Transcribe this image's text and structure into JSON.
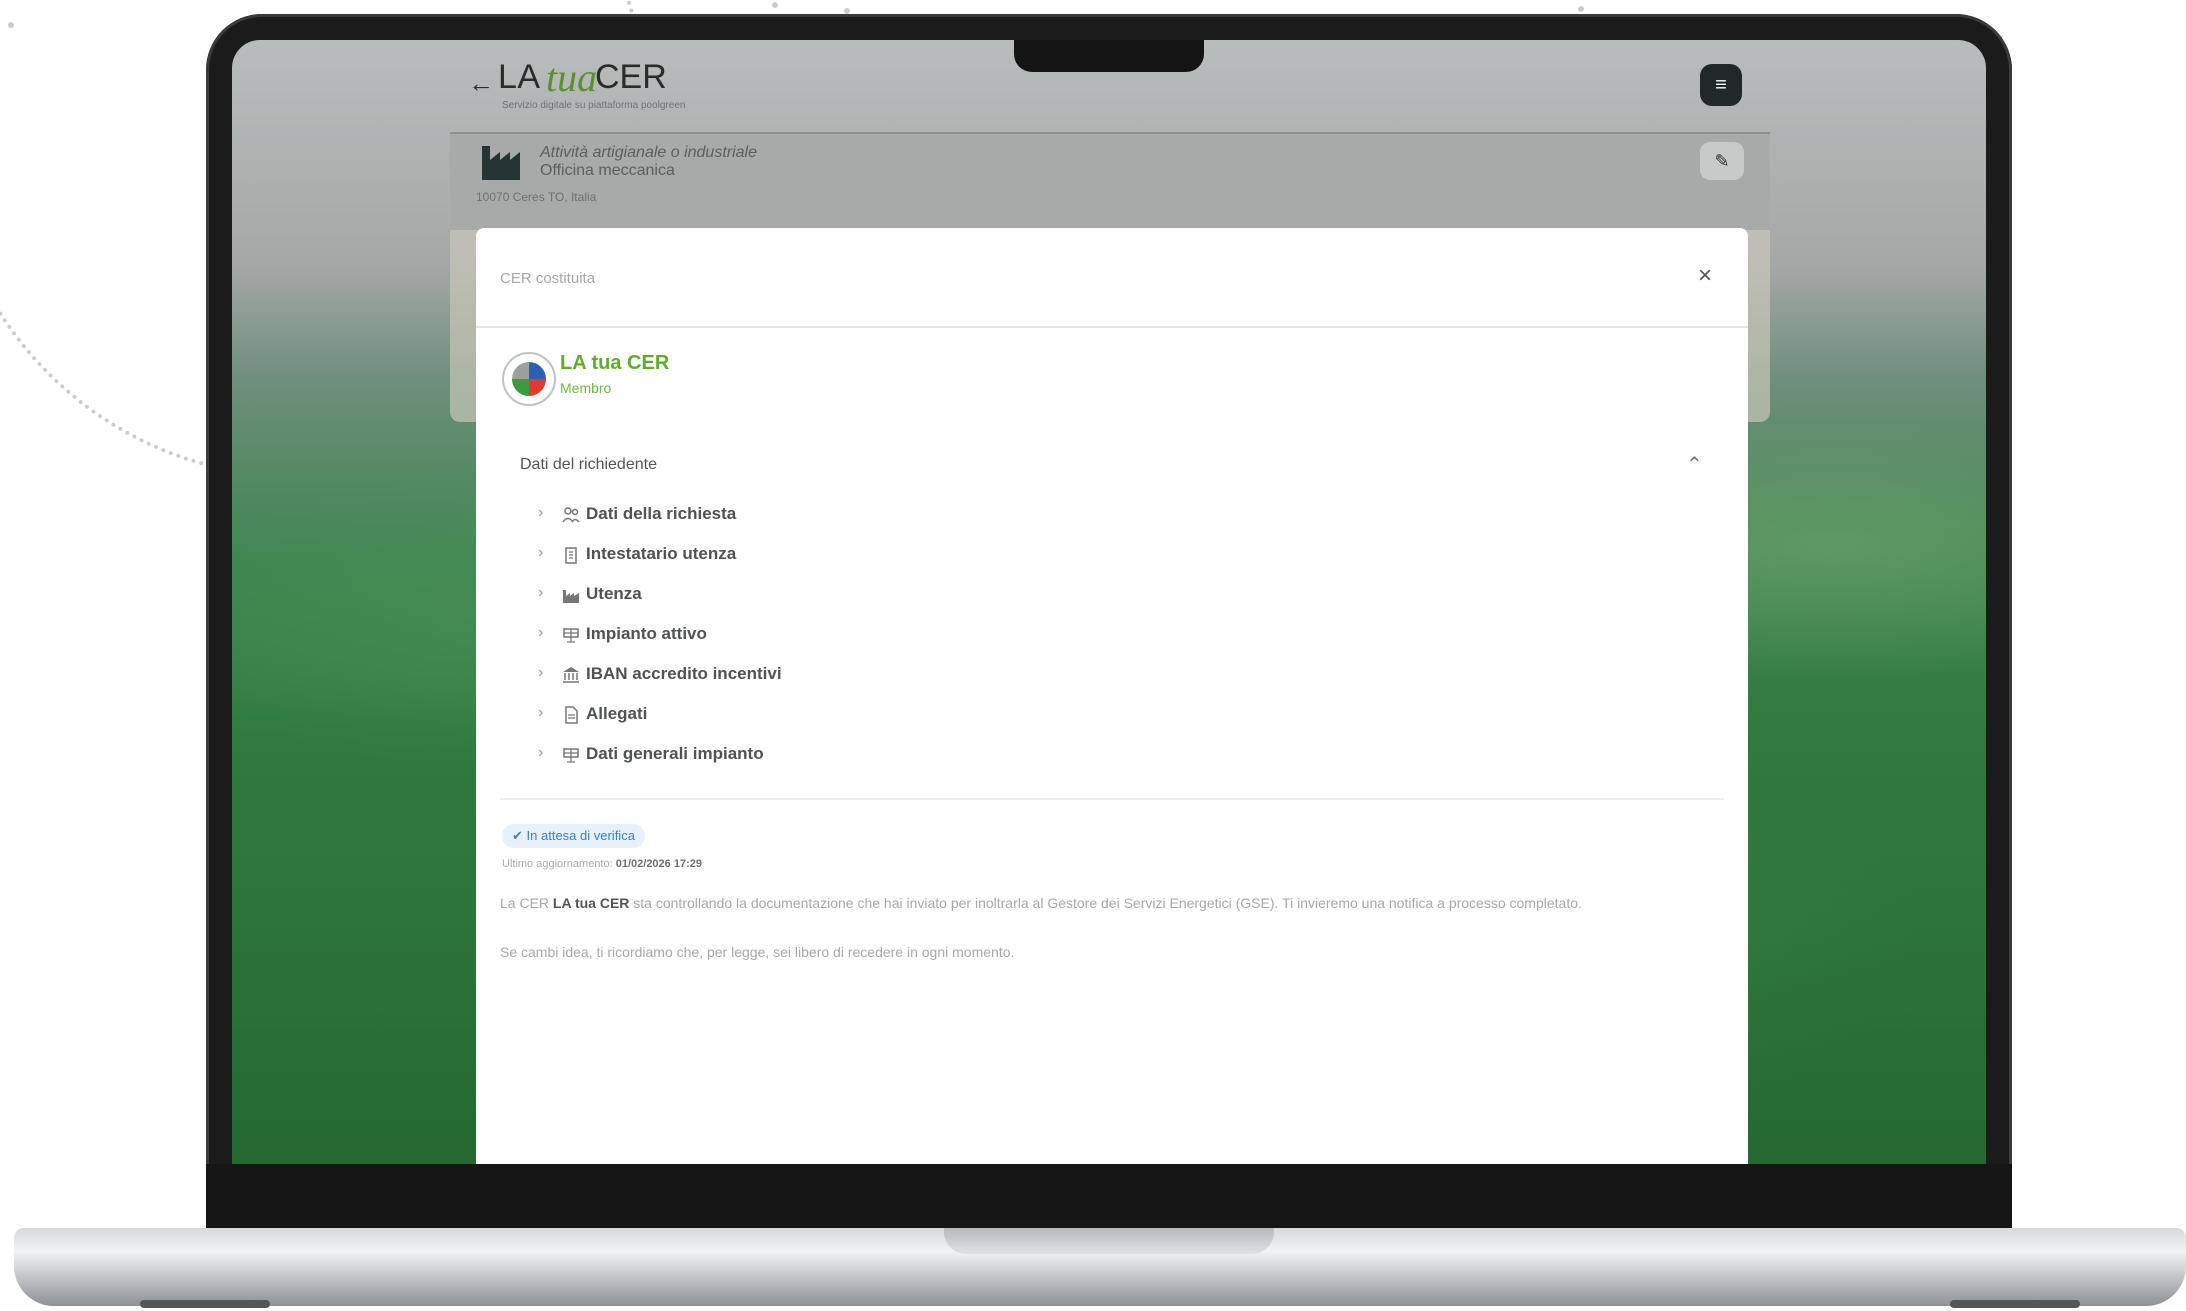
{
  "header": {
    "logo_la": "LA",
    "logo_tua": "tua",
    "logo_cer": "CER",
    "tagline": "Servizio digitale su piattaforma poolgreen"
  },
  "activity": {
    "title": "Attività artigianale o industriale",
    "subtitle": "Officina meccanica",
    "address": "10070 Ceres TO, Italia"
  },
  "modal": {
    "title": "CER costituita",
    "close_symbol": "×",
    "org_name": "LA tua CER",
    "org_role": "Membro",
    "section_title": "Dati del richiedente",
    "items": [
      {
        "label": "Dati della richiesta",
        "icon": "users-icon"
      },
      {
        "label": "Intestatario utenza",
        "icon": "building-icon"
      },
      {
        "label": "Utenza",
        "icon": "factory-icon"
      },
      {
        "label": "Impianto attivo",
        "icon": "solar-panel-icon"
      },
      {
        "label": "IBAN accredito incentivi",
        "icon": "bank-icon"
      },
      {
        "label": "Allegati",
        "icon": "document-icon"
      },
      {
        "label": "Dati generali impianto",
        "icon": "solar-panel-icon"
      }
    ],
    "status": "In attesa di verifica",
    "last_update_label": "Ultimo aggiornamento:",
    "last_update_value": "01/02/2026 17:29",
    "message_prefix": "La CER",
    "message_bold": "LA tua CER",
    "message_rest": "sta controllando la documentazione che hai inviato per inoltrarla al Gestore dei Servizi Energetici (GSE). Ti invieremo una notifica a processo completato.",
    "message_2": "Se cambi idea, ti ricordiamo che, per legge, sei libero di recedere in ogni momento."
  },
  "colors": {
    "brand_green": "#5fae2b",
    "status_blue": "#3b7fc4"
  }
}
